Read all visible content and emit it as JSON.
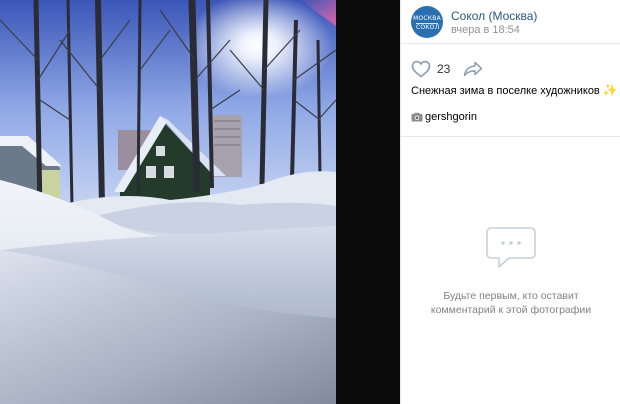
{
  "post": {
    "author_name": "Сокол (Москва)",
    "author_time": "вчера в 18:54",
    "avatar_line1": "МОСКВА",
    "avatar_line2": "СОКОЛ",
    "likes_count": "23",
    "caption": "Снежная зима в поселке художников",
    "caption_emoji": "✨",
    "tag_username": "gershgorin"
  },
  "comments": {
    "empty_line1": "Будьте первым, кто оставит",
    "empty_line2": "комментарий к этой фотографии"
  },
  "icons": {
    "like": "heart-icon",
    "share": "share-arrow-icon",
    "tag": "camera-icon",
    "empty_comments": "comment-bubble-icon"
  },
  "colors": {
    "link": "#2a5885",
    "muted": "#939393",
    "avatar": "#2a6fb0",
    "icon_gray": "#8a9bb0"
  }
}
